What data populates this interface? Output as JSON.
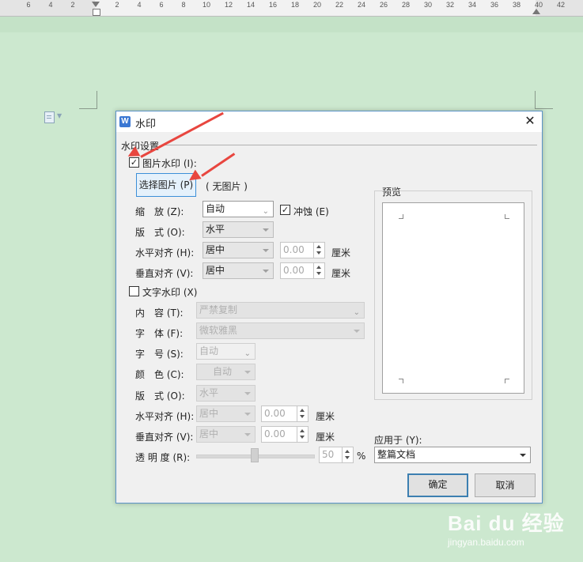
{
  "ruler": {
    "labels": [
      "6",
      "4",
      "2",
      "2",
      "4",
      "6",
      "8",
      "10",
      "12",
      "14",
      "16",
      "18",
      "20",
      "22",
      "24",
      "26",
      "28",
      "30",
      "32",
      "34",
      "36",
      "38",
      "40",
      "42"
    ]
  },
  "dialog": {
    "title": "水印",
    "close": "✕",
    "section_label": "水印设置",
    "picture": {
      "checkbox_label": "图片水印 (I):",
      "checked": true,
      "select_button": "选择图片 (P)",
      "no_picture": "( 无图片 )",
      "scale_label": "缩　放 (Z):",
      "scale_value": "自动",
      "washout_label": "冲蚀 (E)",
      "washout_checked": true,
      "layout_label": "版　式 (O):",
      "layout_value": "水平",
      "halign_label": "水平对齐 (H):",
      "halign_value": "居中",
      "halign_offset": "0.00",
      "valign_label": "垂直对齐 (V):",
      "valign_value": "居中",
      "valign_offset": "0.00",
      "unit": "厘米"
    },
    "text": {
      "checkbox_label": "文字水印 (X)",
      "checked": false,
      "content_label": "内　容 (T):",
      "content_value": "严禁复制",
      "font_label": "字　体 (F):",
      "font_value": "微软雅黑",
      "size_label": "字　号 (S):",
      "size_value": "自动",
      "color_label": "颜　色 (C):",
      "color_value": "自动",
      "layout_label": "版　式 (O):",
      "layout_value": "水平",
      "halign_label": "水平对齐 (H):",
      "halign_value": "居中",
      "halign_offset": "0.00",
      "valign_label": "垂直对齐 (V):",
      "valign_value": "居中",
      "valign_offset": "0.00",
      "unit": "厘米",
      "transparency_label": "透 明 度 (R):",
      "transparency_value": "50",
      "transparency_unit": "%"
    },
    "preview_label": "预览",
    "apply_label": "应用于 (Y):",
    "apply_value": "整篇文档",
    "ok_button": "确定",
    "cancel_button": "取消"
  },
  "watermark": {
    "logo": "Bai du 经验",
    "url": "jingyan.baidu.com"
  },
  "colors": {
    "background": "#cce8cf",
    "dialog_border": "#5b93c7",
    "arrow": "#e8463f",
    "primary_border": "#3c7fb1"
  }
}
